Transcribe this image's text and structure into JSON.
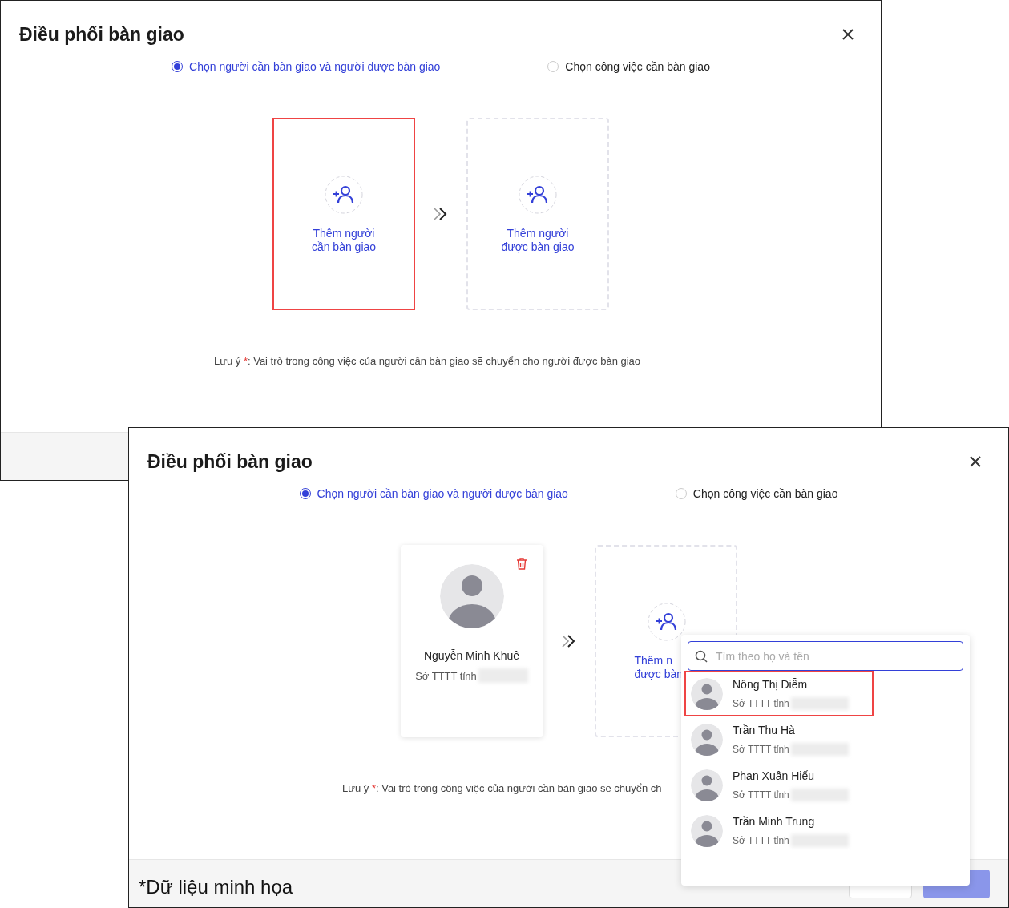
{
  "windows": [
    {
      "title": "Điều phối bàn giao",
      "steps": [
        {
          "label": "Chọn người cần bàn giao và người được bàn giao",
          "selected": true
        },
        {
          "label": "Chọn công việc cần bàn giao",
          "selected": false
        }
      ],
      "cards": [
        {
          "kind": "add",
          "label_lines": [
            "Thêm người",
            "cần bàn giao"
          ],
          "highlighted": true
        },
        {
          "kind": "add",
          "label_lines": [
            "Thêm người",
            "được bàn giao"
          ],
          "highlighted": false
        }
      ],
      "note": {
        "label": "Lưu ý",
        "required_mark": "*",
        "text": ": Vai trò trong công việc của người cần bàn giao sẽ chuyển cho người được bàn giao"
      }
    },
    {
      "title": "Điều phối bàn giao",
      "steps": [
        {
          "label": "Chọn người cần bàn giao và người được bàn giao",
          "selected": true
        },
        {
          "label": "Chọn công việc cần bàn giao",
          "selected": false
        }
      ],
      "cards": [
        {
          "kind": "person",
          "name": "Nguyễn Minh Khuê",
          "org": "Sở TTTT tỉnh",
          "highlighted": false
        },
        {
          "kind": "add",
          "label_lines": [
            "Thêm n",
            "được bàn"
          ],
          "highlighted": false
        }
      ],
      "note": {
        "label": "Lưu ý",
        "required_mark": "*",
        "text": ": Vai trò trong công việc của người cần bàn giao sẽ chuyển ch"
      },
      "dropdown": {
        "search": {
          "placeholder": "Tìm theo họ và tên"
        },
        "items": [
          {
            "name": "Nông Thị Diễm",
            "org": "Sở TTTT tỉnh",
            "highlighted": true
          },
          {
            "name": "Trần Thu Hà",
            "org": "Sở TTTT tỉnh",
            "highlighted": false
          },
          {
            "name": "Phan Xuân Hiếu",
            "org": "Sở TTTT tỉnh",
            "highlighted": false
          },
          {
            "name": "Trần Minh Trung",
            "org": "Sở TTTT tỉnh",
            "highlighted": false
          }
        ]
      },
      "footer": {
        "caption": "*Dữ liệu minh họa",
        "buttons": [
          {
            "kind": "secondary",
            "disabled": false
          },
          {
            "kind": "primary",
            "disabled": true
          }
        ]
      }
    }
  ]
}
